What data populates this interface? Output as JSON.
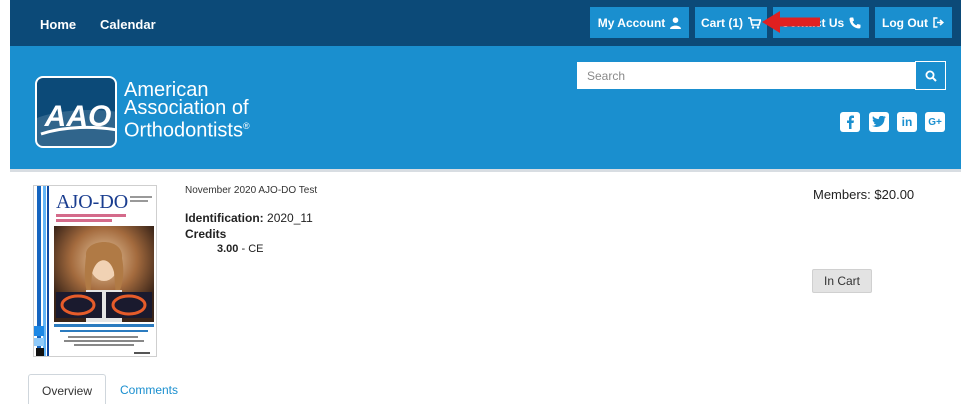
{
  "topnav": {
    "home": "Home",
    "calendar": "Calendar",
    "my_account": "My Account",
    "cart": "Cart (1)",
    "contact": "Contact Us",
    "logout": "Log Out"
  },
  "banner": {
    "logo_line1": "American",
    "logo_line2": "Association of",
    "logo_line3": "Orthodontists",
    "badge": "AAO",
    "search_placeholder": "Search",
    "social_icons": [
      "facebook-icon",
      "twitter-icon",
      "linkedin-icon",
      "google-plus-icon"
    ]
  },
  "product": {
    "cover_title": "AJO-DO",
    "title": "November 2020 AJO-DO Test",
    "identification_label": "Identification:",
    "identification_value": "2020_11",
    "credits_label": "Credits",
    "credits_amount": "3.00",
    "credits_type": "- CE",
    "price": "Members: $20.00",
    "cart_status": "In Cart"
  },
  "tabs": {
    "overview": "Overview",
    "comments": "Comments"
  },
  "colors": {
    "topbar": "#0c4a78",
    "accent": "#1a8fcf",
    "annotation_arrow": "#e02020"
  }
}
